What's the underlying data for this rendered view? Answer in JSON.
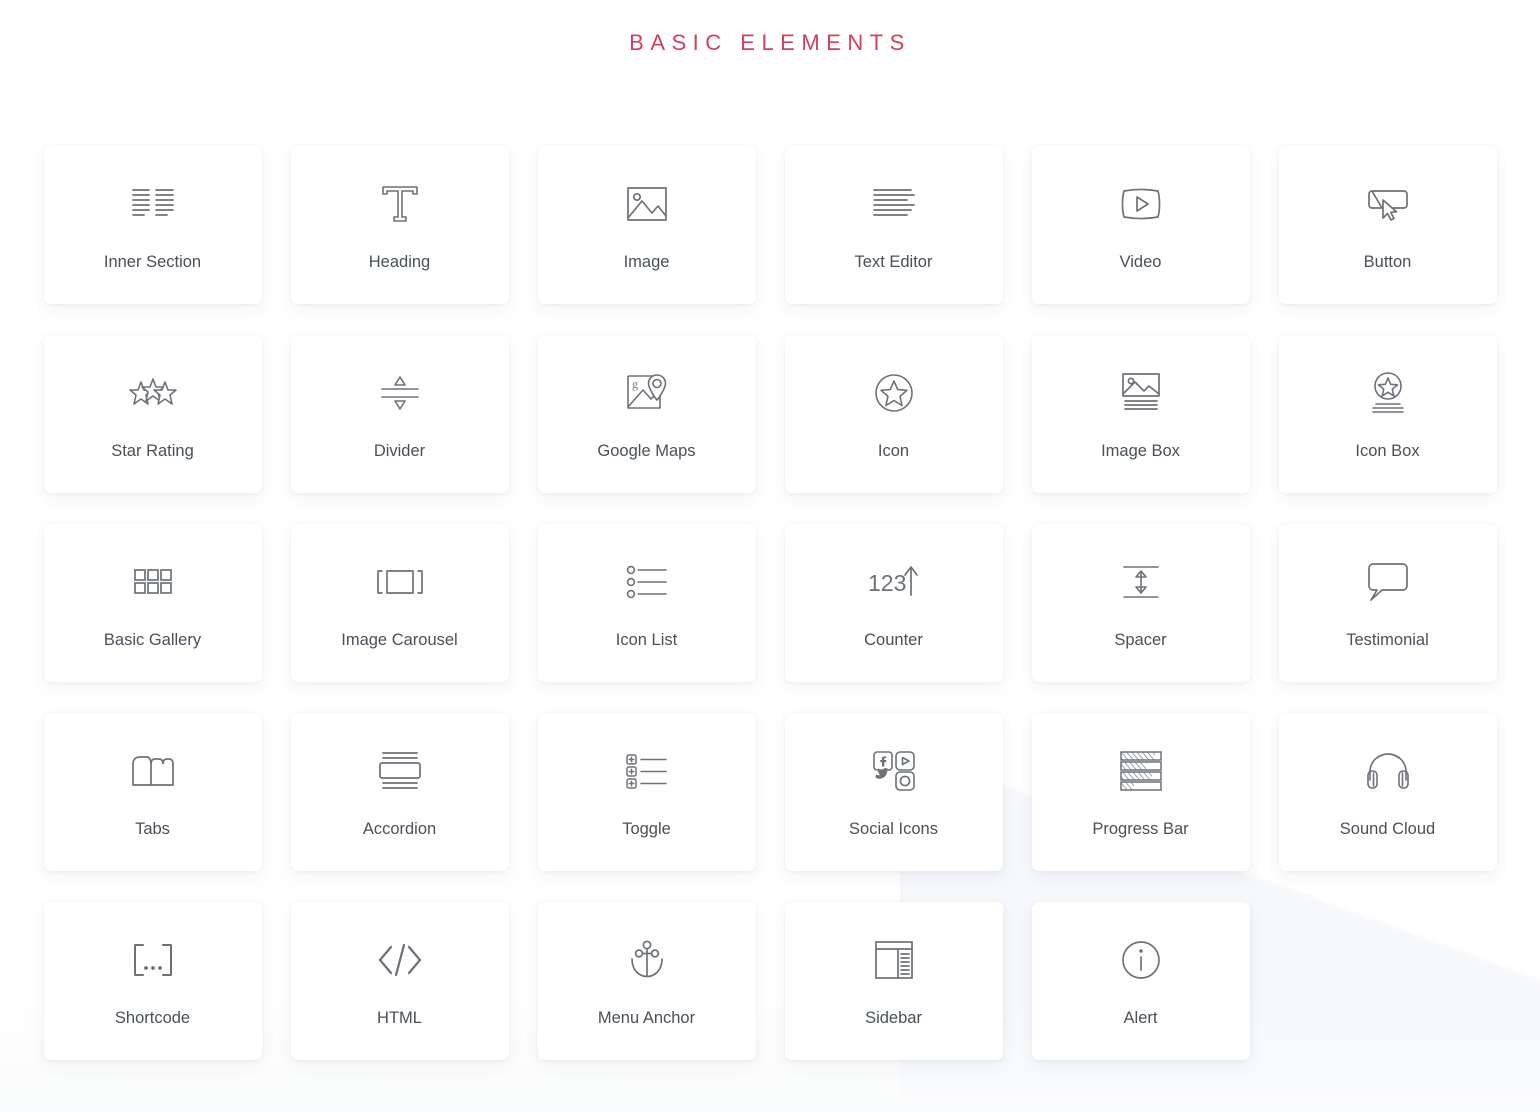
{
  "header": {
    "title": "BASIC ELEMENTS",
    "title_color": "#d4415f"
  },
  "theme": {
    "card_background": "#ffffff",
    "page_background": "#ffffff",
    "icon_color": "#6d7278",
    "label_color": "#4a5058"
  },
  "grid": {
    "columns": 6,
    "items": [
      {
        "label": "Inner Section",
        "icon": "inner-section-icon"
      },
      {
        "label": "Heading",
        "icon": "heading-t-icon"
      },
      {
        "label": "Image",
        "icon": "image-icon"
      },
      {
        "label": "Text Editor",
        "icon": "text-editor-icon"
      },
      {
        "label": "Video",
        "icon": "video-play-icon"
      },
      {
        "label": "Button",
        "icon": "button-cursor-icon"
      },
      {
        "label": "Star Rating",
        "icon": "star-rating-icon"
      },
      {
        "label": "Divider",
        "icon": "divider-icon"
      },
      {
        "label": "Google Maps",
        "icon": "google-maps-icon"
      },
      {
        "label": "Icon",
        "icon": "star-circle-icon"
      },
      {
        "label": "Image Box",
        "icon": "image-box-icon"
      },
      {
        "label": "Icon Box",
        "icon": "icon-box-icon"
      },
      {
        "label": "Basic Gallery",
        "icon": "gallery-grid-icon"
      },
      {
        "label": "Image Carousel",
        "icon": "carousel-icon"
      },
      {
        "label": "Icon List",
        "icon": "icon-list-icon"
      },
      {
        "label": "Counter",
        "icon": "counter-123-icon"
      },
      {
        "label": "Spacer",
        "icon": "spacer-icon"
      },
      {
        "label": "Testimonial",
        "icon": "speech-bubble-icon"
      },
      {
        "label": "Tabs",
        "icon": "tabs-folder-icon"
      },
      {
        "label": "Accordion",
        "icon": "accordion-icon"
      },
      {
        "label": "Toggle",
        "icon": "toggle-plus-list-icon"
      },
      {
        "label": "Social Icons",
        "icon": "social-icons-icon"
      },
      {
        "label": "Progress Bar",
        "icon": "progress-bar-icon"
      },
      {
        "label": "Sound Cloud",
        "icon": "headphones-icon"
      },
      {
        "label": "Shortcode",
        "icon": "shortcode-brackets-icon"
      },
      {
        "label": "HTML",
        "icon": "code-tag-icon"
      },
      {
        "label": "Menu Anchor",
        "icon": "anchor-icon"
      },
      {
        "label": "Sidebar",
        "icon": "sidebar-layout-icon"
      },
      {
        "label": "Alert",
        "icon": "info-circle-icon"
      }
    ]
  }
}
